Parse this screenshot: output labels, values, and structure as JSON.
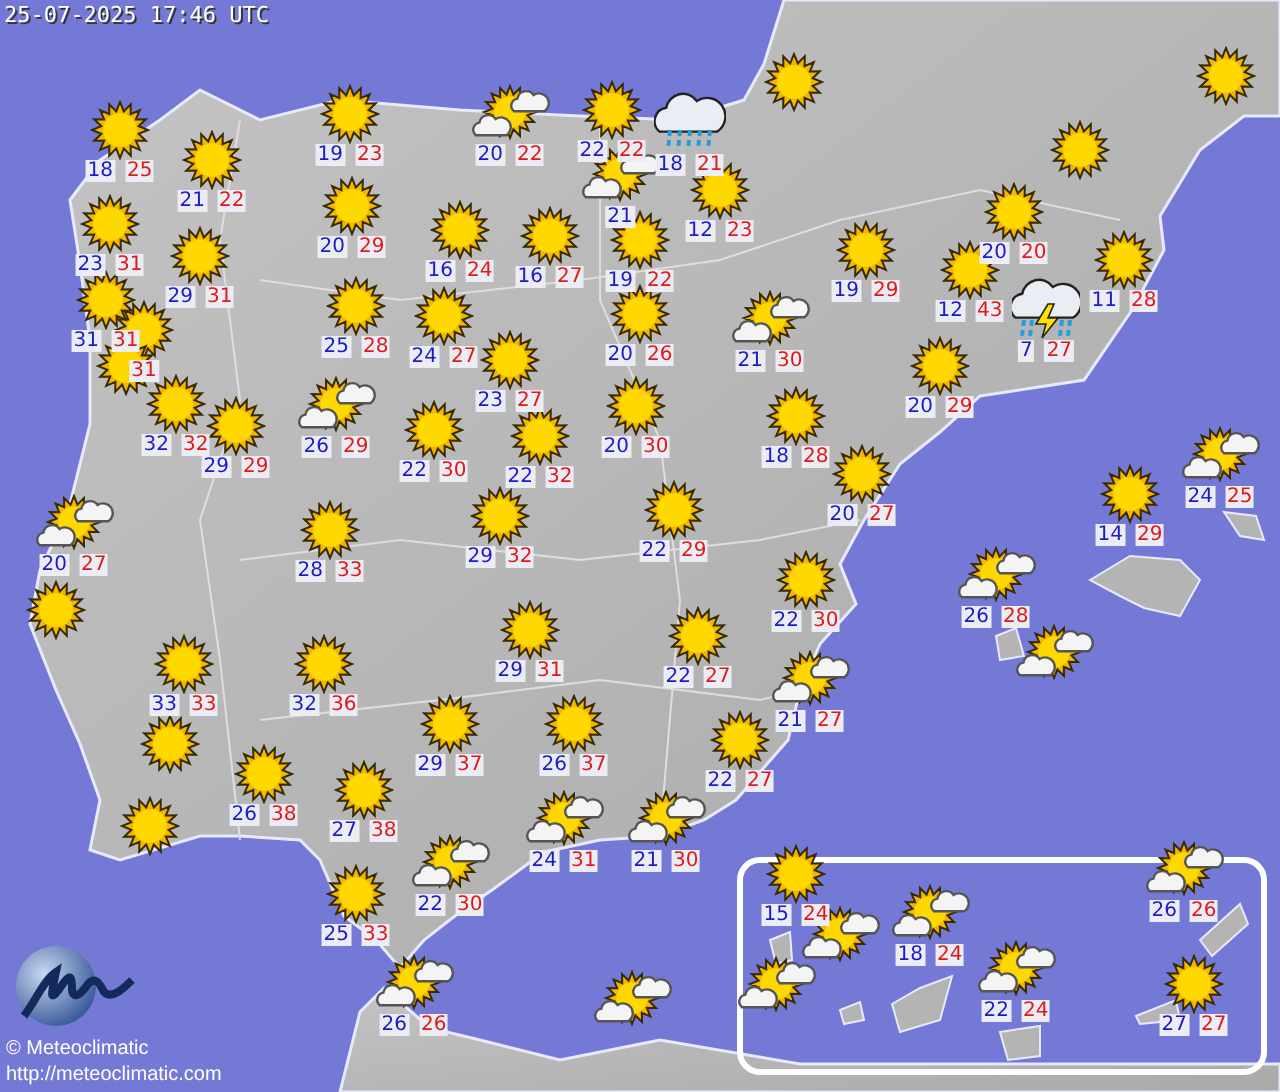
{
  "timestamp": "25-07-2025 17:46 UTC",
  "stations": [
    {
      "kind": "sun",
      "min": "18",
      "max": "25"
    },
    {
      "kind": "sun",
      "min": "21",
      "max": "22"
    },
    {
      "kind": "sun",
      "min": "19",
      "max": "23"
    },
    {
      "kind": "suncloud",
      "min": "20",
      "max": "22"
    },
    {
      "kind": "sun",
      "min": "22",
      "max": "22"
    },
    {
      "kind": "suncloud",
      "min": "21"
    },
    {
      "kind": "rain",
      "min": "18",
      "max": "21"
    },
    {
      "kind": "sun",
      "min": "12",
      "max": "23"
    },
    {
      "kind": "sun",
      "min": "23",
      "max": "31"
    },
    {
      "kind": "sun",
      "min": "29",
      "max": "31"
    },
    {
      "kind": "sun",
      "min": "20",
      "max": "29"
    },
    {
      "kind": "sun",
      "min": "16",
      "max": "24"
    },
    {
      "kind": "sun",
      "min": "16",
      "max": "27"
    },
    {
      "kind": "sun",
      "min": "19",
      "max": "22"
    },
    {
      "kind": "sun"
    },
    {
      "kind": "sun"
    },
    {
      "kind": "sun"
    },
    {
      "kind": "sun",
      "min": "20",
      "max": "20"
    },
    {
      "kind": "sun",
      "min": "19",
      "max": "29"
    },
    {
      "kind": "sun",
      "min": "11",
      "max": "28"
    },
    {
      "kind": "sun",
      "min": "12",
      "max": "43"
    },
    {
      "kind": "storm",
      "min": "7",
      "max": "27"
    },
    {
      "kind": "suncloud",
      "min": "21",
      "max": "30"
    },
    {
      "kind": "sun",
      "max": "31"
    },
    {
      "kind": "sun",
      "min": "31",
      "max": "31"
    },
    {
      "kind": "sun"
    },
    {
      "kind": "sun",
      "min": "25",
      "max": "28"
    },
    {
      "kind": "sun",
      "min": "24",
      "max": "27"
    },
    {
      "kind": "sun",
      "min": "20",
      "max": "26"
    },
    {
      "kind": "sun",
      "min": "23",
      "max": "27"
    },
    {
      "kind": "sun",
      "min": "32",
      "max": "32"
    },
    {
      "kind": "sun",
      "min": "29",
      "max": "29"
    },
    {
      "kind": "suncloud",
      "min": "26",
      "max": "29"
    },
    {
      "kind": "sun",
      "min": "22",
      "max": "30"
    },
    {
      "kind": "sun",
      "min": "22",
      "max": "32"
    },
    {
      "kind": "sun",
      "min": "20",
      "max": "30"
    },
    {
      "kind": "sun",
      "min": "18",
      "max": "28"
    },
    {
      "kind": "sun",
      "min": "20",
      "max": "29"
    },
    {
      "kind": "sun",
      "min": "20",
      "max": "27"
    },
    {
      "kind": "sun",
      "min": "28",
      "max": "33"
    },
    {
      "kind": "sun",
      "min": "29",
      "max": "32"
    },
    {
      "kind": "suncloud",
      "min": "20",
      "max": "27"
    },
    {
      "kind": "sun"
    },
    {
      "kind": "sun",
      "min": "22",
      "max": "29"
    },
    {
      "kind": "sun",
      "min": "22",
      "max": "30"
    },
    {
      "kind": "sun",
      "min": "14",
      "max": "29"
    },
    {
      "kind": "suncloud",
      "min": "24",
      "max": "25"
    },
    {
      "kind": "suncloud",
      "min": "26",
      "max": "28"
    },
    {
      "kind": "suncloud"
    },
    {
      "kind": "sun",
      "min": "33",
      "max": "33"
    },
    {
      "kind": "sun",
      "min": "32",
      "max": "36"
    },
    {
      "kind": "sun",
      "min": "29",
      "max": "31"
    },
    {
      "kind": "sun",
      "min": "22",
      "max": "27"
    },
    {
      "kind": "suncloud",
      "min": "21",
      "max": "27"
    },
    {
      "kind": "sun"
    },
    {
      "kind": "sun",
      "min": "29",
      "max": "37"
    },
    {
      "kind": "sun",
      "min": "26",
      "max": "37"
    },
    {
      "kind": "sun",
      "min": "22",
      "max": "27"
    },
    {
      "kind": "sun",
      "min": "26",
      "max": "38"
    },
    {
      "kind": "sun",
      "min": "27",
      "max": "38"
    },
    {
      "kind": "sun"
    },
    {
      "kind": "suncloud",
      "min": "24",
      "max": "31"
    },
    {
      "kind": "suncloud",
      "min": "21",
      "max": "30"
    },
    {
      "kind": "suncloud",
      "min": "22",
      "max": "30"
    },
    {
      "kind": "sun",
      "min": "25",
      "max": "33"
    },
    {
      "kind": "suncloud",
      "min": "26",
      "max": "26"
    },
    {
      "kind": "suncloud"
    },
    {
      "kind": "sun",
      "min": "15",
      "max": "24"
    },
    {
      "kind": "suncloud"
    },
    {
      "kind": "suncloud",
      "min": "18",
      "max": "24"
    },
    {
      "kind": "suncloud"
    },
    {
      "kind": "suncloud",
      "min": "22",
      "max": "24"
    },
    {
      "kind": "suncloud",
      "min": "26",
      "max": "26"
    },
    {
      "kind": "sun",
      "min": "27",
      "max": "27"
    }
  ],
  "logo": {
    "copyright": "© Meteoclimatic",
    "url": "http://meteoclimatic.com"
  }
}
